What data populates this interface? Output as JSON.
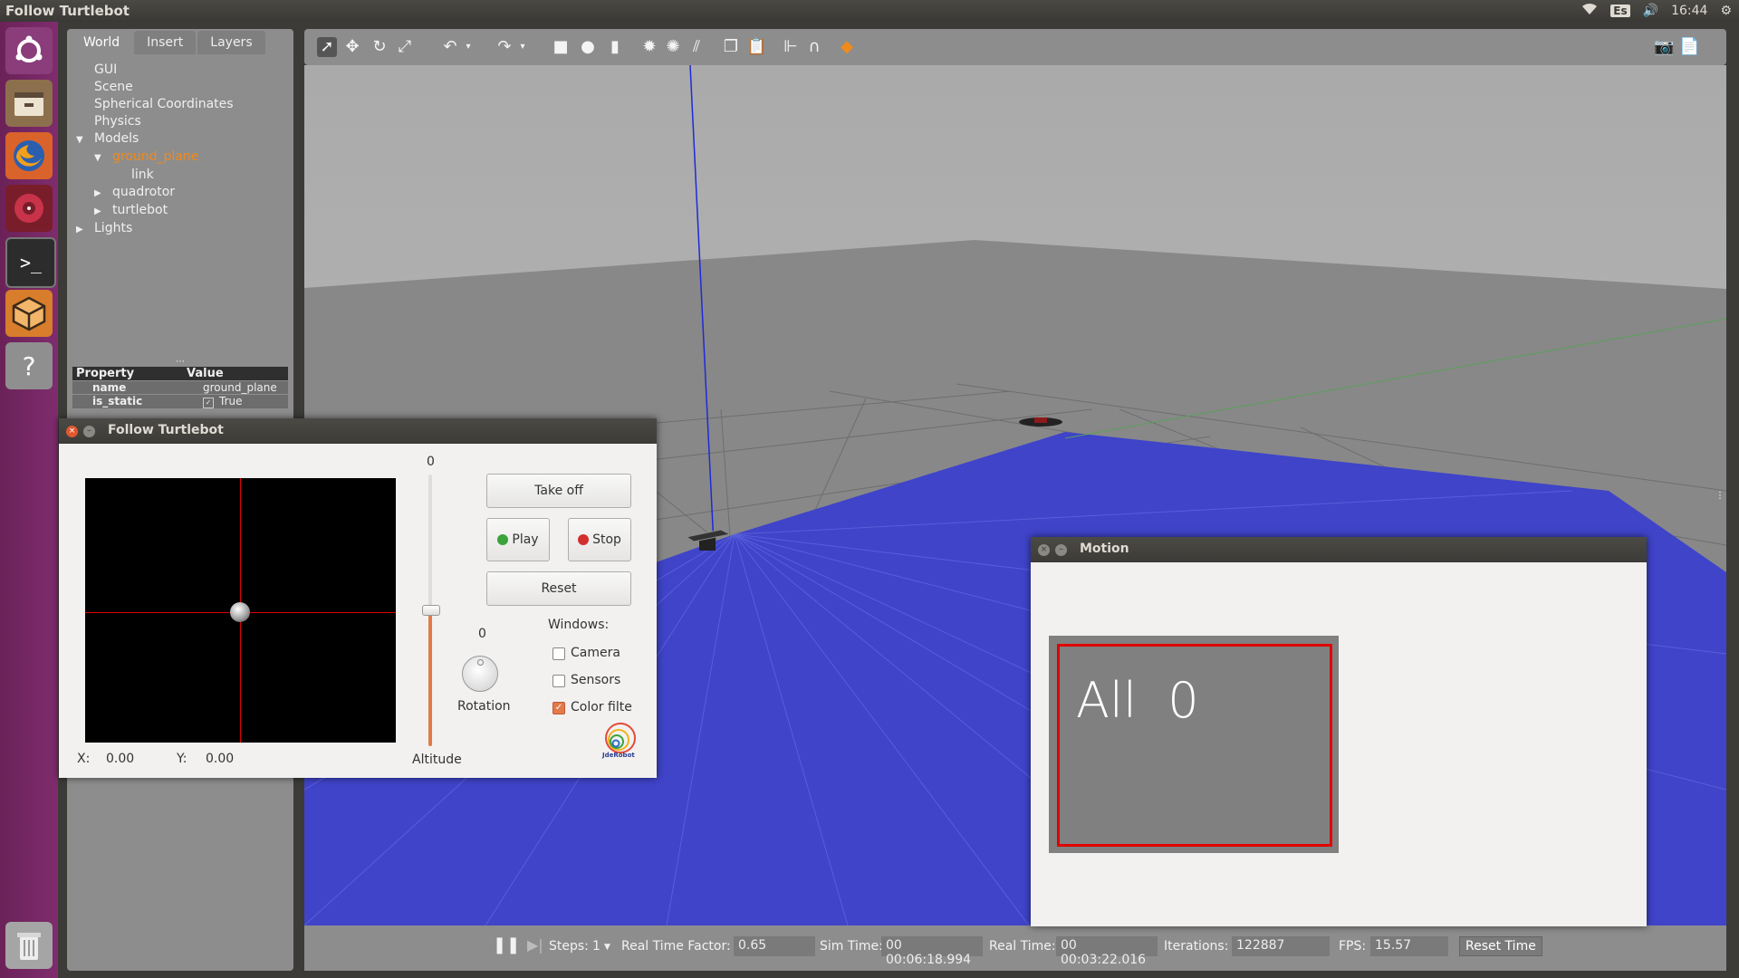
{
  "topbar": {
    "title": "Follow Turtlebot",
    "keyboard_layout": "Es",
    "time": "16:44",
    "icons": [
      "wifi-icon",
      "keyboard-icon",
      "volume-icon",
      "gear-icon"
    ]
  },
  "launcher": {
    "items": [
      "ubuntu-dash-icon",
      "files-icon",
      "firefox-icon",
      "rhythmbox-icon",
      "terminal-icon",
      "gazebo-icon",
      "help-icon",
      "trash-icon"
    ],
    "terminal_glyph": ">_",
    "help_glyph": "?"
  },
  "left_panel": {
    "tabs": [
      {
        "label": "World"
      },
      {
        "label": "Insert"
      },
      {
        "label": "Layers"
      }
    ],
    "tree": [
      {
        "label": "GUI"
      },
      {
        "label": "Scene"
      },
      {
        "label": "Spherical Coordinates"
      },
      {
        "label": "Physics"
      },
      {
        "label": "Models"
      },
      {
        "label": "ground_plane"
      },
      {
        "label": "link"
      },
      {
        "label": "quadrotor"
      },
      {
        "label": "turtlebot"
      },
      {
        "label": "Lights"
      }
    ],
    "properties": {
      "header_property": "Property",
      "header_value": "Value",
      "rows": [
        {
          "name": "name",
          "value": "ground_plane"
        },
        {
          "name": "is_static",
          "value": "True"
        }
      ]
    }
  },
  "bottom_bar": {
    "steps_label": "Steps:",
    "steps_value": "1",
    "rtf_label": "Real Time Factor:",
    "rtf_value": "0.65",
    "sim_time_label": "Sim Time:",
    "sim_time_value": "00 00:06:18.994",
    "real_time_label": "Real Time:",
    "real_time_value": "00 00:03:22.016",
    "iterations_label": "Iterations:",
    "iterations_value": "122887",
    "fps_label": "FPS:",
    "fps_value": "15.57",
    "reset_time": "Reset Time"
  },
  "follow_dialog": {
    "title": "Follow Turtlebot",
    "altitude_value": "0",
    "altitude_label": "Altitude",
    "rotation_value": "0",
    "rotation_label": "Rotation",
    "x_label": "X:",
    "x_value": "0.00",
    "y_label": "Y:",
    "y_value": "0.00",
    "take_off": "Take off",
    "play": "Play",
    "stop": "Stop",
    "reset": "Reset",
    "windows_label": "Windows:",
    "checkboxes": [
      {
        "label": "Camera",
        "checked": false
      },
      {
        "label": "Sensors",
        "checked": false
      },
      {
        "label": "Color filte",
        "checked": true
      }
    ],
    "logo_text": "JdeRobot"
  },
  "motion_window": {
    "title": "Motion",
    "display_text": "All  0"
  },
  "colors": {
    "accent_orange": "#f08a1c",
    "floor_grid_blue": "#3b3bd9",
    "motion_box_red": "#e00000",
    "launcher_purple": "#7a2a67"
  }
}
